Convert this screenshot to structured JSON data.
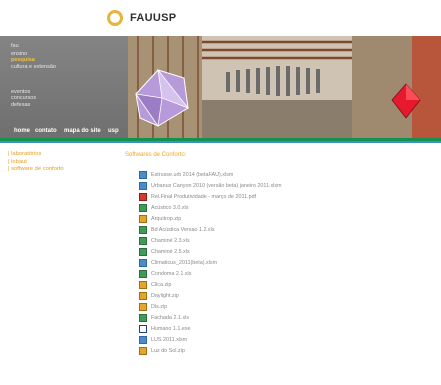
{
  "logo": {
    "text": "FAUUSP"
  },
  "nav": {
    "items": [
      {
        "label": "fau",
        "active": false
      },
      {
        "label": "ensino",
        "active": false
      },
      {
        "label": "pesquisa",
        "active": true
      },
      {
        "label": "cultura e extensão",
        "active": false
      },
      {
        "label": "eventos",
        "active": false
      },
      {
        "label": "concursos",
        "active": false
      },
      {
        "label": "defesas",
        "active": false
      }
    ],
    "bottom": [
      "home",
      "contato",
      "mapa do site",
      "usp"
    ]
  },
  "sidebar": {
    "links": [
      "laboratórios",
      "lobaut",
      "software de conforto"
    ]
  },
  "content": {
    "title": "Softwares de Conforto:",
    "files": [
      {
        "name": "Estrusse.urb 2014 (betaFAU).xlsm",
        "type": "xsm"
      },
      {
        "name": "Urbanus Canyon 2010 (versão beta) janeiro 2011.xlsm",
        "type": "xsm"
      },
      {
        "name": "Rel.Final Produtividade - março de 2011.pdf",
        "type": "pdf"
      },
      {
        "name": "Acústico 3.0.xls",
        "type": "xls"
      },
      {
        "name": "Arquitrop.zip",
        "type": "zip"
      },
      {
        "name": "Bd Acústica Versao 1.2.xls",
        "type": "xls"
      },
      {
        "name": "Chaminé 2.3.xls",
        "type": "xls"
      },
      {
        "name": "Chaminé 2.5.xls",
        "type": "xls"
      },
      {
        "name": "Climaticus_2011(beta).xlsm",
        "type": "xsm"
      },
      {
        "name": "Condoma 2.1.xls",
        "type": "xls"
      },
      {
        "name": "Clica.zip",
        "type": "zip"
      },
      {
        "name": "Daylight.zip",
        "type": "zip"
      },
      {
        "name": "Dis.zip",
        "type": "zip"
      },
      {
        "name": "Fachada 2.1.xls",
        "type": "xls"
      },
      {
        "name": "Humano 1.1.exe",
        "type": "exe"
      },
      {
        "name": "LUS 2011.xlsm",
        "type": "xsm"
      },
      {
        "name": "Luz do Sol.zip",
        "type": "zip"
      }
    ]
  },
  "colors": {
    "accent": "#f0a625",
    "green_stripe": "#15914f",
    "blue_stripe": "#3d8fc4"
  }
}
